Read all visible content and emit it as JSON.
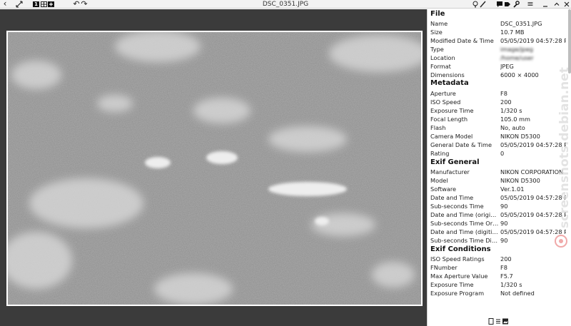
{
  "window": {
    "title": "DSC_0351.JPG"
  },
  "toolbar": {
    "back_glyph": "‹",
    "fullscreen_icon": "fullscreen-icon",
    "page_number": "1",
    "rotate_left": "↶",
    "rotate_right": "↷",
    "menu_glyph": "≡"
  },
  "panel": {
    "file": {
      "heading": "File",
      "rows": [
        {
          "k": "Name",
          "v": "DSC_0351.JPG"
        },
        {
          "k": "Size",
          "v": "10.7 MB"
        },
        {
          "k": "Modified Date & Time",
          "v": "05/05/2019 04:57:28 PM"
        },
        {
          "k": "Type",
          "v": "image/jpeg"
        },
        {
          "k": "Location",
          "v": "/home/user"
        },
        {
          "k": "Format",
          "v": "JPEG"
        },
        {
          "k": "Dimensions",
          "v": "6000 × 4000"
        }
      ]
    },
    "metadata": {
      "heading": "Metadata",
      "rows": [
        {
          "k": "Aperture",
          "v": "F8"
        },
        {
          "k": "ISO Speed",
          "v": "200"
        },
        {
          "k": "Exposure Time",
          "v": "1/320 s"
        },
        {
          "k": "Focal Length",
          "v": "105.0 mm"
        },
        {
          "k": "Flash",
          "v": "No, auto"
        },
        {
          "k": "Camera Model",
          "v": "NIKON D5300"
        },
        {
          "k": "General Date & Time",
          "v": "05/05/2019 04:57:28 PM"
        },
        {
          "k": "Rating",
          "v": "0"
        }
      ]
    },
    "exif_general": {
      "heading": "Exif General",
      "rows": [
        {
          "k": "Manufacturer",
          "v": "NIKON CORPORATION"
        },
        {
          "k": "Model",
          "v": "NIKON D5300"
        },
        {
          "k": "Software",
          "v": "Ver.1.01"
        },
        {
          "k": "Date and Time",
          "v": "05/05/2019 04:57:28 PM"
        },
        {
          "k": "Sub-seconds Time",
          "v": "90"
        },
        {
          "k": "Date and Time (original)",
          "v": "05/05/2019 04:57:28 PM"
        },
        {
          "k": "Sub-seconds Time Orig...",
          "v": "90"
        },
        {
          "k": "Date and Time (digitized)",
          "v": "05/05/2019 04:57:28 PM"
        },
        {
          "k": "Sub-seconds Time Digi...",
          "v": "90"
        }
      ]
    },
    "exif_conditions": {
      "heading": "Exif Conditions",
      "rows": [
        {
          "k": "ISO Speed Ratings",
          "v": "200"
        },
        {
          "k": "FNumber",
          "v": "F8"
        },
        {
          "k": "Max Aperture Value",
          "v": "F5.7"
        },
        {
          "k": "Exposure Time",
          "v": "1/320 s"
        },
        {
          "k": "Exposure Program",
          "v": "Not defined"
        }
      ]
    }
  },
  "watermark": {
    "text": "screenshots.debian.net"
  },
  "colors": {
    "viewer_bg": "#3b3b3b",
    "panel_bg": "#ffffff",
    "toolbar_bg": "#f2f2f2"
  }
}
